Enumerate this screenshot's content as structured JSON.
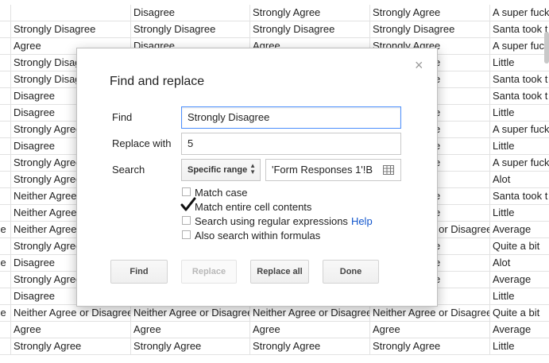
{
  "sheet": {
    "rows": [
      [
        "",
        "",
        "Disagree",
        "Strongly Agree",
        "Strongly Agree",
        "A super fuck"
      ],
      [
        "",
        "Strongly Disagree",
        "Strongly Disagree",
        "Strongly Disagree",
        "Strongly Disagree",
        "Santa took t"
      ],
      [
        "",
        "Agree",
        "Disagree",
        "Agree",
        "Strongly Agree",
        "A super fuck"
      ],
      [
        "",
        "Strongly Disagree",
        "",
        "",
        "Strongly Agree",
        "Little"
      ],
      [
        "",
        "Strongly Disagree",
        "",
        "",
        "Strongly Agree",
        "Santa took t"
      ],
      [
        "",
        "Disagree",
        "",
        "",
        "",
        "Santa took t"
      ],
      [
        "",
        "Disagree",
        "",
        "",
        "Strongly Agree",
        "Little"
      ],
      [
        "",
        "Strongly Agree",
        "",
        "",
        "Strongly Agree",
        "A super fuck"
      ],
      [
        "",
        "Disagree",
        "",
        "",
        "Strongly Agree",
        "Little"
      ],
      [
        "",
        "Strongly Agree",
        "",
        "",
        "Strongly Agree",
        "A super fuck"
      ],
      [
        "",
        "Strongly Agree",
        "",
        "",
        "",
        "Alot"
      ],
      [
        "",
        "Neither Agree",
        "",
        "",
        "Strongly Agree",
        "Santa took t"
      ],
      [
        "",
        "Neither Agree",
        "",
        "",
        "Strongly Agree",
        "Little"
      ],
      [
        "ree",
        "Neither Agree",
        "",
        "",
        "Neither Agree or Disagree",
        "Average"
      ],
      [
        "",
        "Strongly Agree",
        "",
        "",
        "Strongly Agree",
        "Quite a bit"
      ],
      [
        "ree",
        "Disagree",
        "",
        "",
        "Strongly Agree",
        "Alot"
      ],
      [
        "",
        "Strongly Agree",
        "",
        "",
        "Strongly Agree",
        "Average"
      ],
      [
        "",
        "Disagree",
        "",
        "",
        "",
        "Little"
      ],
      [
        "ree",
        "Neither Agree or Disagree",
        "Neither Agree or Disagree",
        "Neither Agree or Disagree",
        "Neither Agree or Disagree",
        "Quite a bit"
      ],
      [
        "",
        "Agree",
        "Agree",
        "Agree",
        "Agree",
        "Average"
      ],
      [
        "",
        "Strongly Agree",
        "Strongly Agree",
        "Strongly Agree",
        "Strongly Agree",
        "Little"
      ]
    ]
  },
  "dialog": {
    "title": "Find and replace",
    "close_glyph": "×",
    "find_label": "Find",
    "find_value": "Strongly Disagree",
    "replace_label": "Replace with",
    "replace_value": "5",
    "search_label": "Search",
    "search_scope": "Specific range",
    "range_value": "'Form Responses 1'!B",
    "options": {
      "match_case": {
        "label": "Match case",
        "checked": false
      },
      "match_entire": {
        "label": "Match entire cell contents",
        "checked": true
      },
      "regex": {
        "label": "Search using regular expressions",
        "checked": false,
        "help": "Help"
      },
      "formulas": {
        "label": "Also search within formulas",
        "checked": false
      }
    },
    "buttons": {
      "find": "Find",
      "replace": "Replace",
      "replace_all": "Replace all",
      "done": "Done"
    }
  },
  "icons": {
    "close": "close-icon",
    "select_arrows": "up-down-arrows-icon",
    "range_picker": "grid-icon",
    "checkmark": "checkmark-icon"
  },
  "colors": {
    "link": "#1155cc",
    "focus_border": "#4d90fe"
  }
}
